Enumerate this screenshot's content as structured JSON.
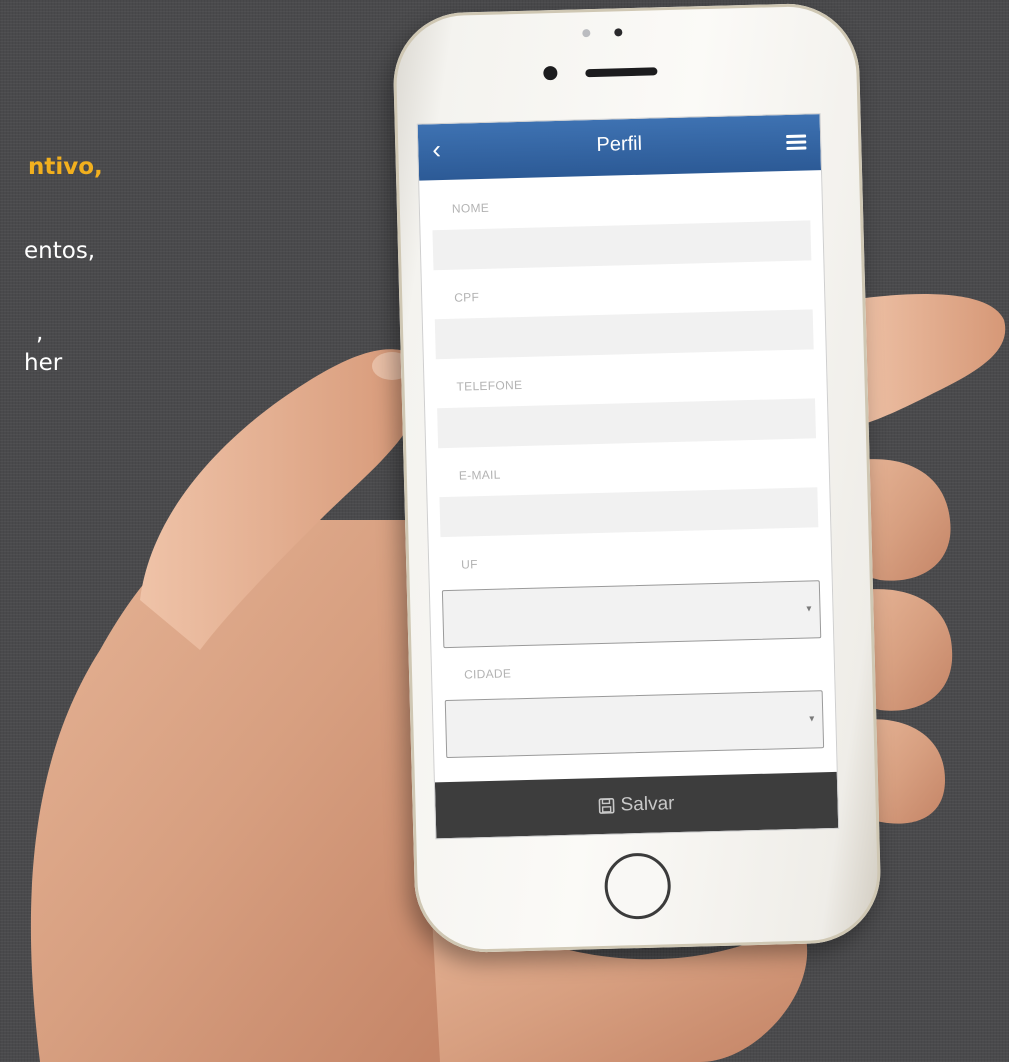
{
  "side_text": {
    "line1": "ntivo,",
    "line2": "entos,",
    "line3": ",",
    "line4": "her"
  },
  "app": {
    "title": "Perfil",
    "back_glyph": "‹",
    "menu_icon": "hamburger-icon",
    "header_color": "#3566a7",
    "accent_color": "#f2b01e"
  },
  "form": {
    "fields": [
      {
        "label": "NOME",
        "value": ""
      },
      {
        "label": "CPF",
        "value": ""
      },
      {
        "label": "TELEFONE",
        "value": ""
      },
      {
        "label": "E-MAIL",
        "value": ""
      }
    ],
    "selects": [
      {
        "label": "UF",
        "value": ""
      },
      {
        "label": "CIDADE",
        "value": ""
      }
    ],
    "caret": "▾"
  },
  "save_button": {
    "label": "Salvar",
    "icon": "floppy-disk-icon"
  }
}
